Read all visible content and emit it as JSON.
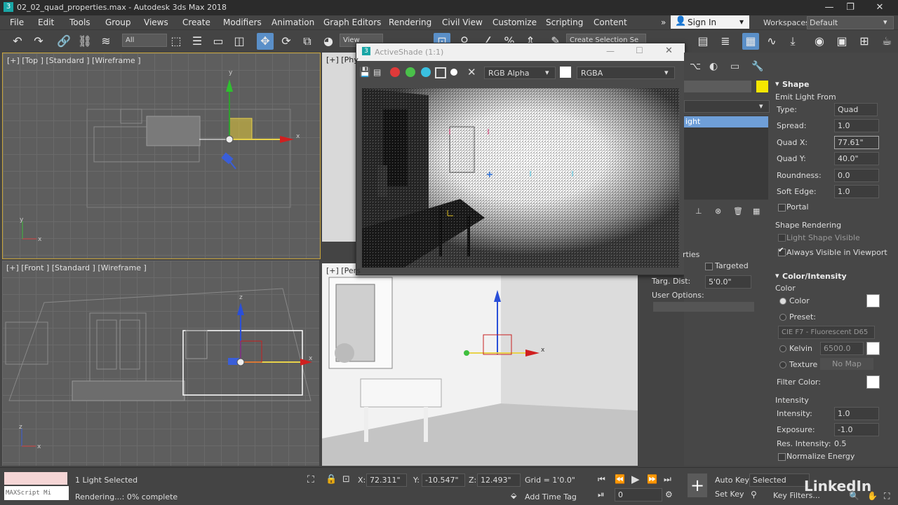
{
  "window": {
    "title": "02_02_quad_properties.max - Autodesk 3ds Max 2018",
    "app_icon": "3",
    "minimize": "—",
    "maximize": "❐",
    "close": "✕"
  },
  "menu": [
    "File",
    "Edit",
    "Tools",
    "Group",
    "Views",
    "Create",
    "Modifiers",
    "Animation",
    "Graph Editors",
    "Rendering",
    "Civil View",
    "Customize",
    "Scripting",
    "Content"
  ],
  "menu_more": "»",
  "account": {
    "sign_in": "Sign In",
    "workspaces_label": "Workspaces:",
    "workspace": "Default"
  },
  "toolbar": {
    "filter": "All",
    "view": "View",
    "selection_set": "Create Selection Se"
  },
  "viewports": {
    "top": {
      "label": "[+] [Top ] [Standard ] [Wireframe ]"
    },
    "physical": {
      "label": "[+] [Phy"
    },
    "front": {
      "label": "[+] [Front ] [Standard ] [Wireframe ]"
    },
    "perspective": {
      "label": "[+] [Pers"
    }
  },
  "activeshade": {
    "title": "ActiveShade (1:1)",
    "channel": "RGB Alpha",
    "display": "RGBA"
  },
  "command_panel": {
    "name_partial": "ight",
    "targ_dist_label": "Targ. Dist:",
    "targ_dist": "5'0.0\"",
    "targeted": "Targeted",
    "user_options": "User Options:",
    "properties_partial": "rties",
    "shape": {
      "header": "Shape",
      "emit_from": "Emit Light From",
      "type_label": "Type:",
      "type": "Quad",
      "spread_label": "Spread:",
      "spread": "1.0",
      "quadx_label": "Quad X:",
      "quadx": "77.61\"",
      "quady_label": "Quad Y:",
      "quady": "40.0\"",
      "roundness_label": "Roundness:",
      "roundness": "0.0",
      "softedge_label": "Soft Edge:",
      "softedge": "1.0",
      "portal": "Portal"
    },
    "shape_rendering": {
      "header": "Shape Rendering",
      "light_shape_visible": "Light Shape Visible",
      "always_visible": "Always Visible in Viewport"
    },
    "color_intensity": {
      "header": "Color/Intensity",
      "color_group": "Color",
      "color": "Color",
      "preset": "Preset:",
      "preset_value": "CIE F7 - Fluorescent D65",
      "kelvin": "Kelvin",
      "kelvin_value": "6500.0",
      "texture": "Texture",
      "no_map": "No Map",
      "filter_color": "Filter Color:",
      "intensity_group": "Intensity",
      "intensity_label": "Intensity:",
      "intensity": "1.0",
      "exposure_label": "Exposure:",
      "exposure": "-1.0",
      "res_label": "Res. Intensity:",
      "res": "0.5",
      "normalize": "Normalize Energy"
    }
  },
  "status": {
    "maxscript": "MAXScript Mi",
    "selected": "1 Light Selected",
    "rendering": "Rendering...: 0% complete",
    "x_label": "X:",
    "x": "72.311\"",
    "y_label": "Y:",
    "y": "-10.547\"",
    "z_label": "Z:",
    "z": "12.493\"",
    "grid": "Grid = 1'0.0\"",
    "add_time_tag": "Add Time Tag",
    "auto_key": "Auto Key",
    "set_key": "Set Key",
    "selected_dropdown": "Selected",
    "key_filters": "Key Filters...",
    "frame": "0",
    "watermark": "LinkedIn"
  },
  "colors": {
    "accent": "#5a8fc8",
    "light_swatch": "#f5e600",
    "selected_row": "#6f9fd8"
  }
}
